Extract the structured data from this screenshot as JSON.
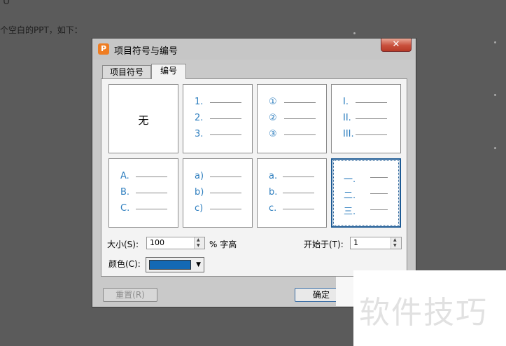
{
  "background": {
    "article_text": "个空白的PPT，如下：",
    "corner_glyph": "U"
  },
  "dialog": {
    "title": "项目符号与编号",
    "app_icon": "P",
    "close": "✕",
    "tabs": [
      {
        "label": "项目符号",
        "active": false
      },
      {
        "label": "编号",
        "active": true
      }
    ],
    "styles": [
      {
        "kind": "none",
        "label": "无"
      },
      {
        "kind": "list",
        "items": [
          "1.",
          "2.",
          "3."
        ]
      },
      {
        "kind": "list",
        "items": [
          "①",
          "②",
          "③"
        ]
      },
      {
        "kind": "list",
        "items": [
          "I.",
          "II.",
          "III."
        ]
      },
      {
        "kind": "list",
        "items": [
          "A.",
          "B.",
          "C."
        ]
      },
      {
        "kind": "list",
        "items": [
          "a)",
          "b)",
          "c)"
        ]
      },
      {
        "kind": "list",
        "items": [
          "a.",
          "b.",
          "c."
        ]
      },
      {
        "kind": "list",
        "items": [
          "一.",
          "二.",
          "三."
        ],
        "selected": true
      }
    ],
    "size_label": "大小(S):",
    "size_value": "100",
    "size_unit": "% 字高",
    "start_label": "开始于(T):",
    "start_value": "1",
    "color_label": "颜色(C):",
    "color_value": "#1469b4",
    "reset_button": "重置(R)",
    "ok_button": "确定",
    "cancel_button": ""
  },
  "watermark": {
    "text": "软件技巧"
  }
}
